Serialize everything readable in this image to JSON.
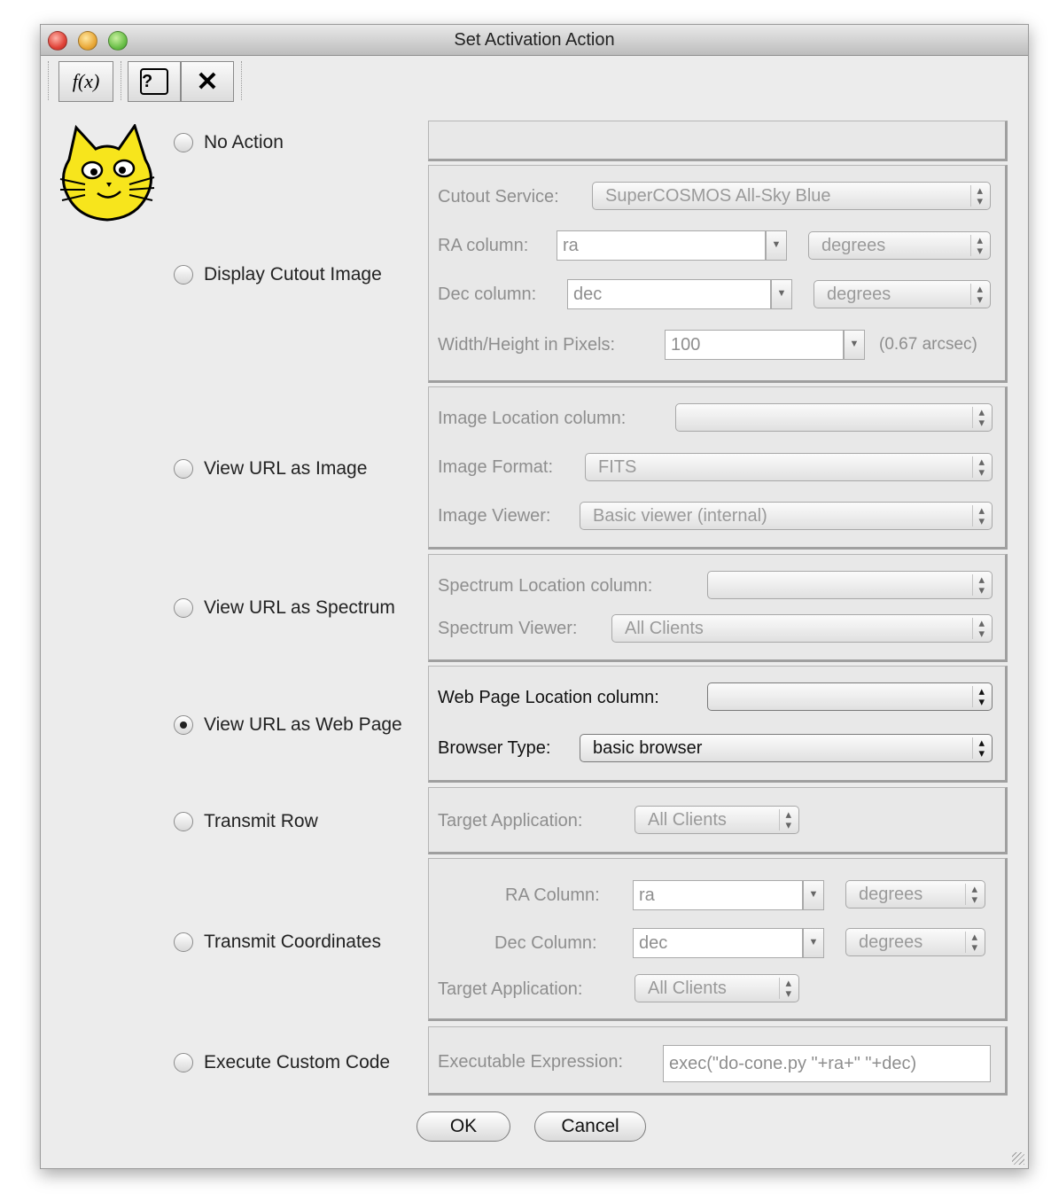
{
  "window": {
    "title": "Set Activation Action"
  },
  "toolbar": {
    "function_label": "f(x)",
    "help_label": "?",
    "close_label": "✕"
  },
  "options": {
    "no_action": "No Action",
    "display_cutout": "Display Cutout Image",
    "view_image": "View URL as Image",
    "view_spectrum": "View URL as Spectrum",
    "view_webpage": "View URL as Web Page",
    "transmit_row": "Transmit Row",
    "transmit_coords": "Transmit Coordinates",
    "custom_code": "Execute Custom Code",
    "selected": "View URL as Web Page"
  },
  "cutout": {
    "service_label": "Cutout Service:",
    "service_value": "SuperCOSMOS All-Sky Blue",
    "ra_label": "RA column:",
    "ra_value": "ra",
    "ra_units": "degrees",
    "dec_label": "Dec column:",
    "dec_value": "dec",
    "dec_units": "degrees",
    "size_label": "Width/Height in Pixels:",
    "size_value": "100",
    "size_note": "(0.67 arcsec)"
  },
  "image": {
    "location_label": "Image Location column:",
    "location_value": "",
    "format_label": "Image Format:",
    "format_value": "FITS",
    "viewer_label": "Image Viewer:",
    "viewer_value": "Basic viewer (internal)"
  },
  "spectrum": {
    "location_label": "Spectrum Location column:",
    "location_value": "",
    "viewer_label": "Spectrum Viewer:",
    "viewer_value": "All Clients"
  },
  "webpage": {
    "location_label": "Web Page Location column:",
    "location_value": "",
    "browser_label": "Browser Type:",
    "browser_value": "basic browser"
  },
  "transmit_row": {
    "target_label": "Target Application:",
    "target_value": "All Clients"
  },
  "transmit_coords": {
    "ra_label": "RA Column:",
    "ra_value": "ra",
    "ra_units": "degrees",
    "dec_label": "Dec Column:",
    "dec_value": "dec",
    "dec_units": "degrees",
    "target_label": "Target Application:",
    "target_value": "All Clients"
  },
  "custom": {
    "expr_label": "Executable Expression:",
    "expr_value": "exec(\"do-cone.py \"+ra+\" \"+dec)"
  },
  "buttons": {
    "ok": "OK",
    "cancel": "Cancel"
  }
}
